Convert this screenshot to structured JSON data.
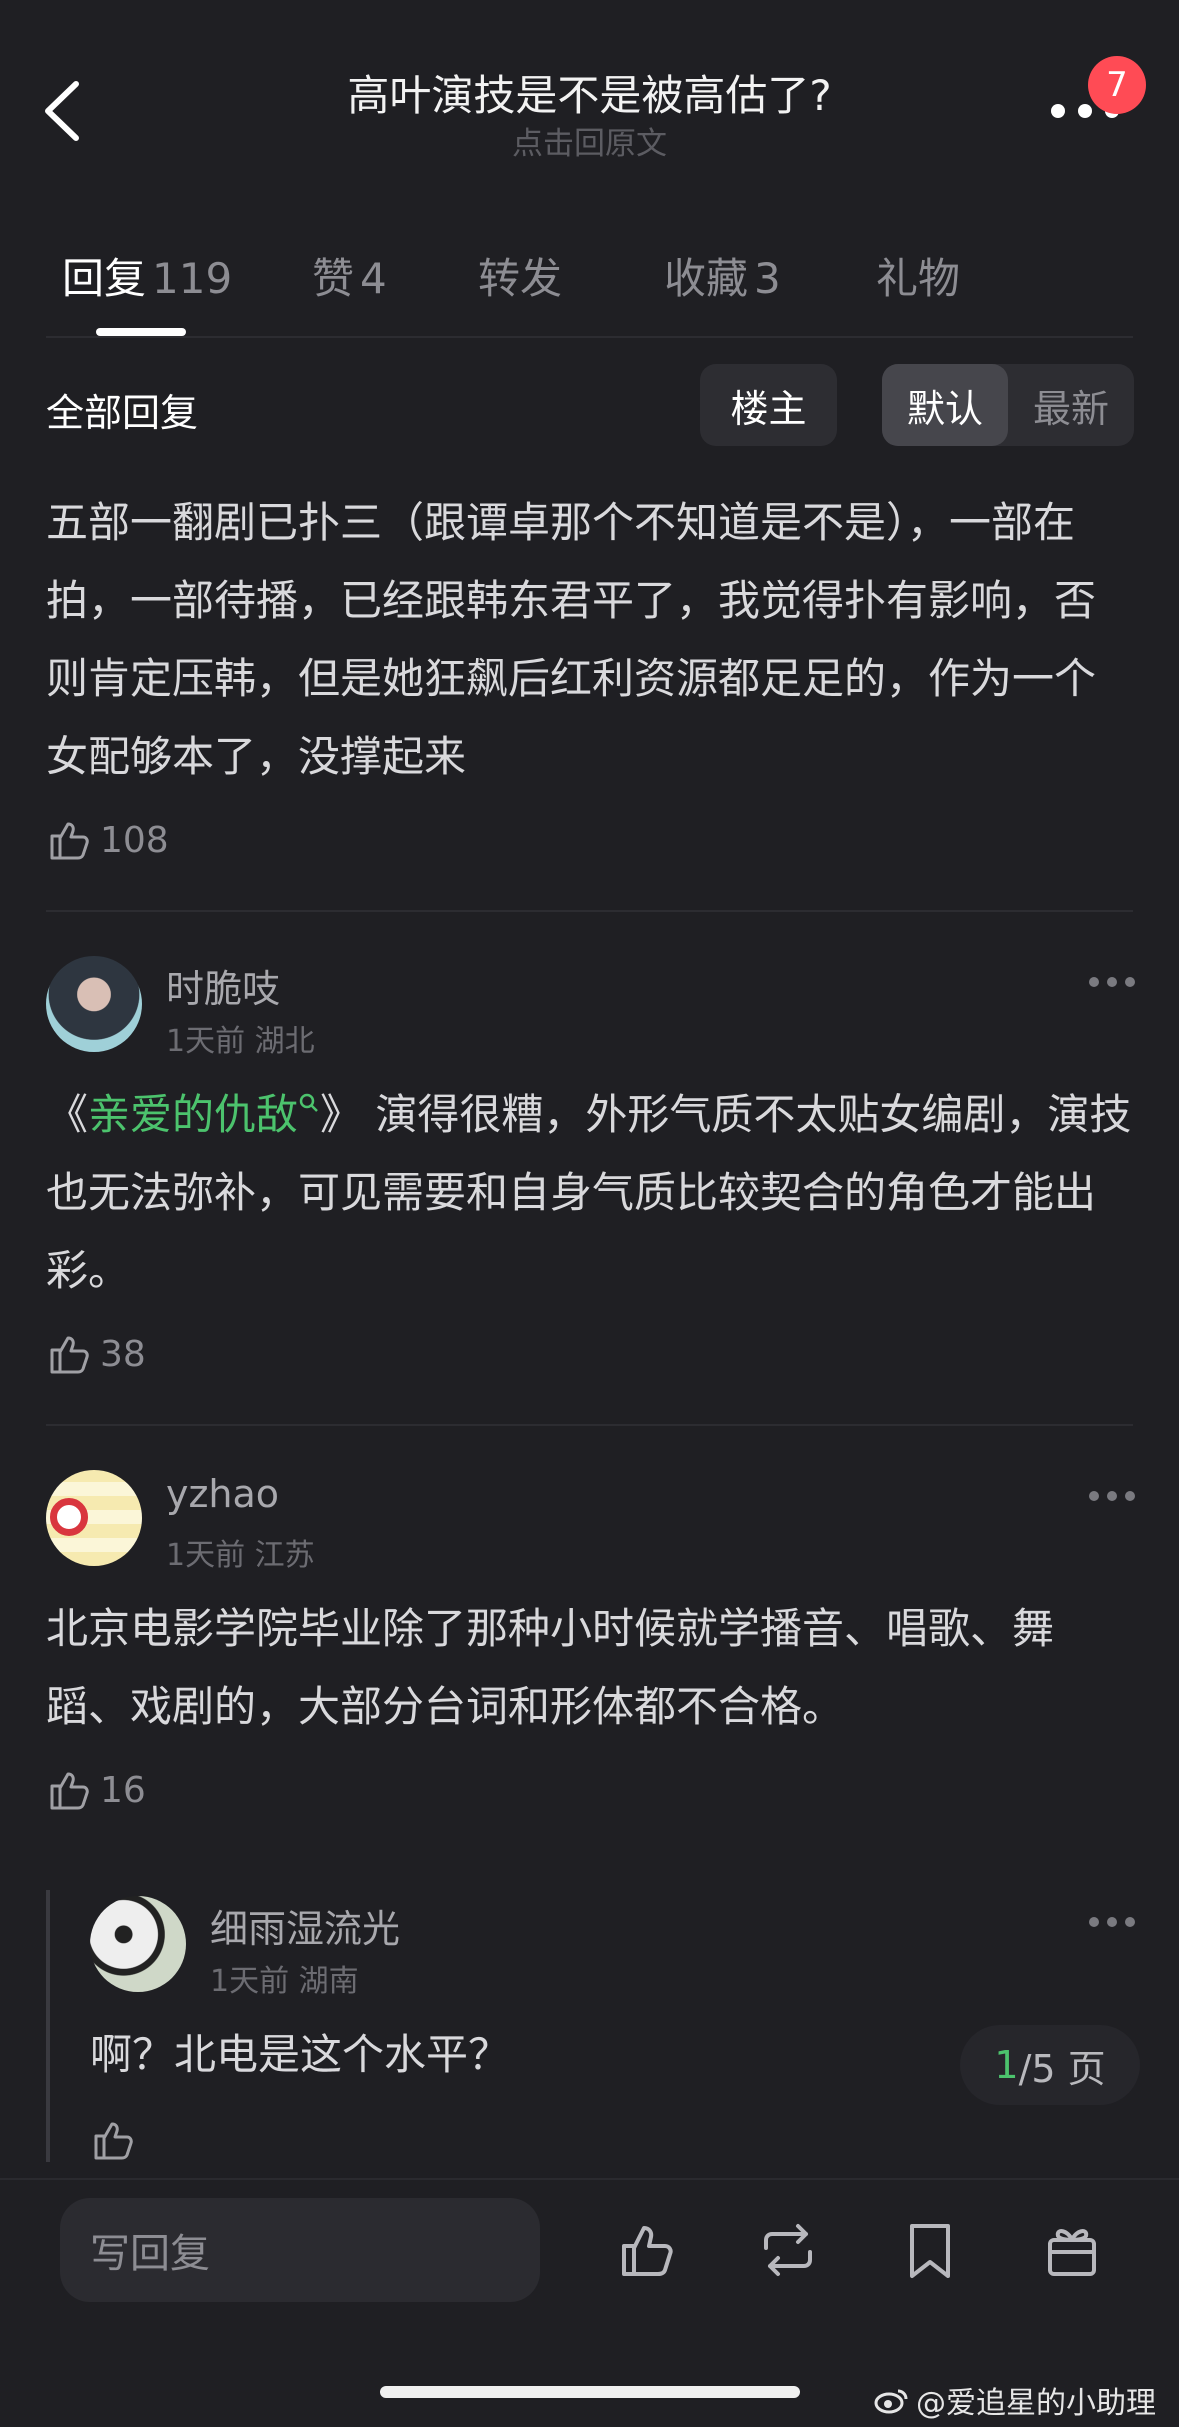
{
  "header": {
    "title": "高叶演技是不是被高估了?",
    "subtitle": "点击回原文",
    "badge_count": "7"
  },
  "tabs": [
    {
      "label": "回复",
      "count": "119"
    },
    {
      "label": "赞",
      "count": "4"
    },
    {
      "label": "转发",
      "count": ""
    },
    {
      "label": "收藏",
      "count": "3"
    },
    {
      "label": "礼物",
      "count": ""
    }
  ],
  "filter": {
    "all_label": "全部回复",
    "op_label": "楼主",
    "sort_default": "默认",
    "sort_latest": "最新"
  },
  "comments": [
    {
      "text": "五部一翻剧已扑三（跟谭卓那个不知道是不是），一部在拍，一部待播，已经跟韩东君平了，我觉得扑有影响，否则肯定压韩，但是她狂飙后红利资源都足足的，作为一个女配够本了，没撑起来",
      "likes": "108"
    },
    {
      "username": "时脆吱",
      "meta": "1天前 湖北",
      "link_prefix": "《",
      "link_text": "亲爱的仇敌",
      "link_suffix": "》",
      "text": "演得很糟，外形气质不太贴女编剧，演技也无法弥补，可见需要和自身气质比较契合的角色才能出彩。",
      "likes": "38"
    },
    {
      "username": "yzhao",
      "meta": "1天前 江苏",
      "text": "北京电影学院毕业除了那种小时候就学播音、唱歌、舞蹈、戏剧的，大部分台词和形体都不合格。",
      "likes": "16"
    },
    {
      "username": "细雨湿流光",
      "meta": "1天前 湖南",
      "text": "啊？北电是这个水平？",
      "likes": ""
    }
  ],
  "pager": {
    "current": "1",
    "total": "/5 页"
  },
  "bottom": {
    "placeholder": "写回复"
  },
  "watermark": "@爱追星的小助理",
  "colors": {
    "background": "#1f1f23",
    "accent_green": "#4cc36d",
    "badge_red": "#ff4b55"
  },
  "icons": [
    "back-icon",
    "more-icon",
    "thumb-up-icon",
    "repost-icon",
    "bookmark-icon",
    "gift-icon",
    "weibo-icon"
  ]
}
